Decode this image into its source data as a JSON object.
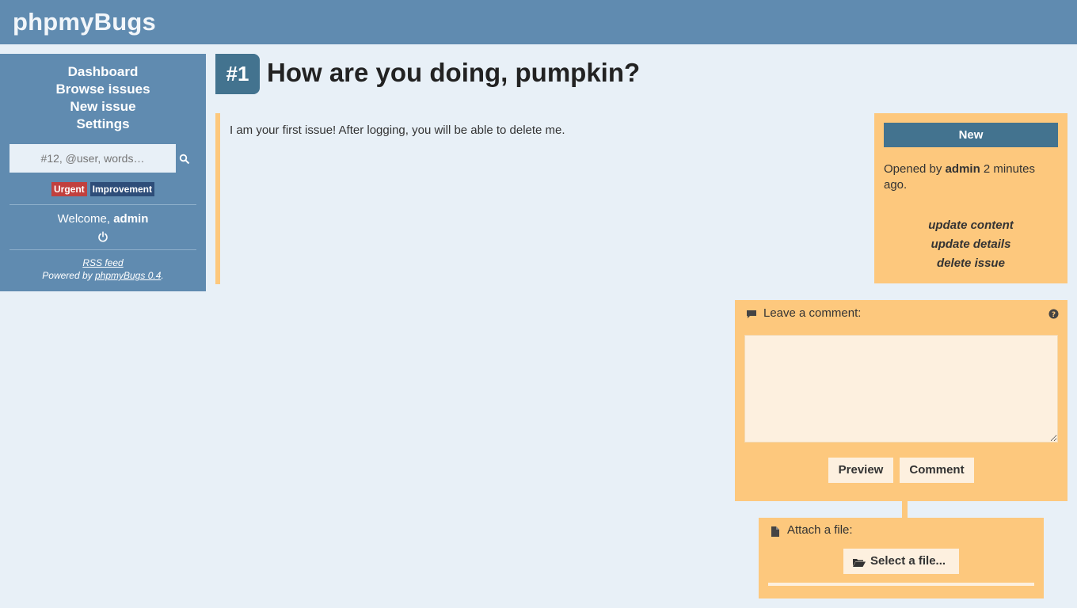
{
  "header": {
    "brand": "phpmyBugs"
  },
  "sidebar": {
    "nav": [
      {
        "label": "Dashboard"
      },
      {
        "label": "Browse issues"
      },
      {
        "label": "New issue"
      },
      {
        "label": "Settings"
      }
    ],
    "search": {
      "placeholder": "#12, @user, words…"
    },
    "tags": [
      {
        "label": "Urgent",
        "color": "#c1403e"
      },
      {
        "label": "Improvement",
        "color": "#2e4d79"
      }
    ],
    "welcome": {
      "prefix": "Welcome, ",
      "user": "admin"
    },
    "footer": {
      "rss": "RSS feed",
      "powered_prefix": "Powered by ",
      "powered_link": "phpmyBugs 0.4",
      "powered_suffix": "."
    }
  },
  "issue": {
    "number": "#1",
    "title": "How are you doing, pumpkin?",
    "content": "I am your first issue! After logging, you will be able to delete me.",
    "status": "New",
    "opened_prefix": "Opened by ",
    "opened_user": "admin",
    "opened_suffix": " 2 minutes ago.",
    "actions": [
      "update content",
      "update details",
      "delete issue"
    ]
  },
  "comment": {
    "label": "Leave a comment:",
    "preview_label": "Preview",
    "submit_label": "Comment",
    "value": ""
  },
  "attach": {
    "label": "Attach a file:",
    "select_label": "Select a file..."
  },
  "colors": {
    "header_bg": "#608bb0",
    "page_bg": "#e8f0f7",
    "accent_orange": "#fdc87d",
    "status_bg": "#43738f"
  }
}
